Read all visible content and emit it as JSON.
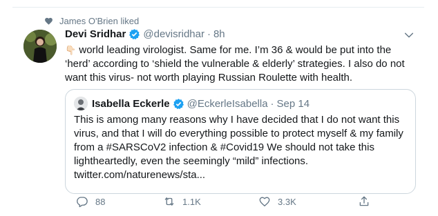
{
  "social_context": {
    "text": "James O'Brien liked"
  },
  "tweet": {
    "author_name": "Devi Sridhar",
    "handle": "@devisridhar",
    "separator": "·",
    "time": "8h",
    "text_line1": "world leading virologist. Same for me. I’m 36 & would be put into the",
    "text_line2": "‘herd’ according to ‘shield the vulnerable & elderly’ strategies. I also do not",
    "text_line3": "want this virus- not worth playing Russian Roulette with health.",
    "emoji": "👇🏻"
  },
  "quoted": {
    "author_name": "Isabella Eckerle",
    "handle": "@EckerleIsabella",
    "separator": "·",
    "time": "Sep 14",
    "line1": "This is among many reasons why I have decided that I do not want this",
    "line2": "virus, and that I will do everything possible to protect myself & my family",
    "line3": "from a #SARSCoV2 infection & #Covid19 We should not take this",
    "line4": "lightheartedly, even the seemingly “mild” infections.",
    "line5": "twitter.com/naturenews/sta..."
  },
  "actions": {
    "reply_count": "88",
    "retweet_count": "1.1K",
    "like_count": "3.3K"
  },
  "colors": {
    "text": "#14171a",
    "secondary": "#657786",
    "verified": "#1da1f2",
    "border": "#ccd6dd"
  }
}
